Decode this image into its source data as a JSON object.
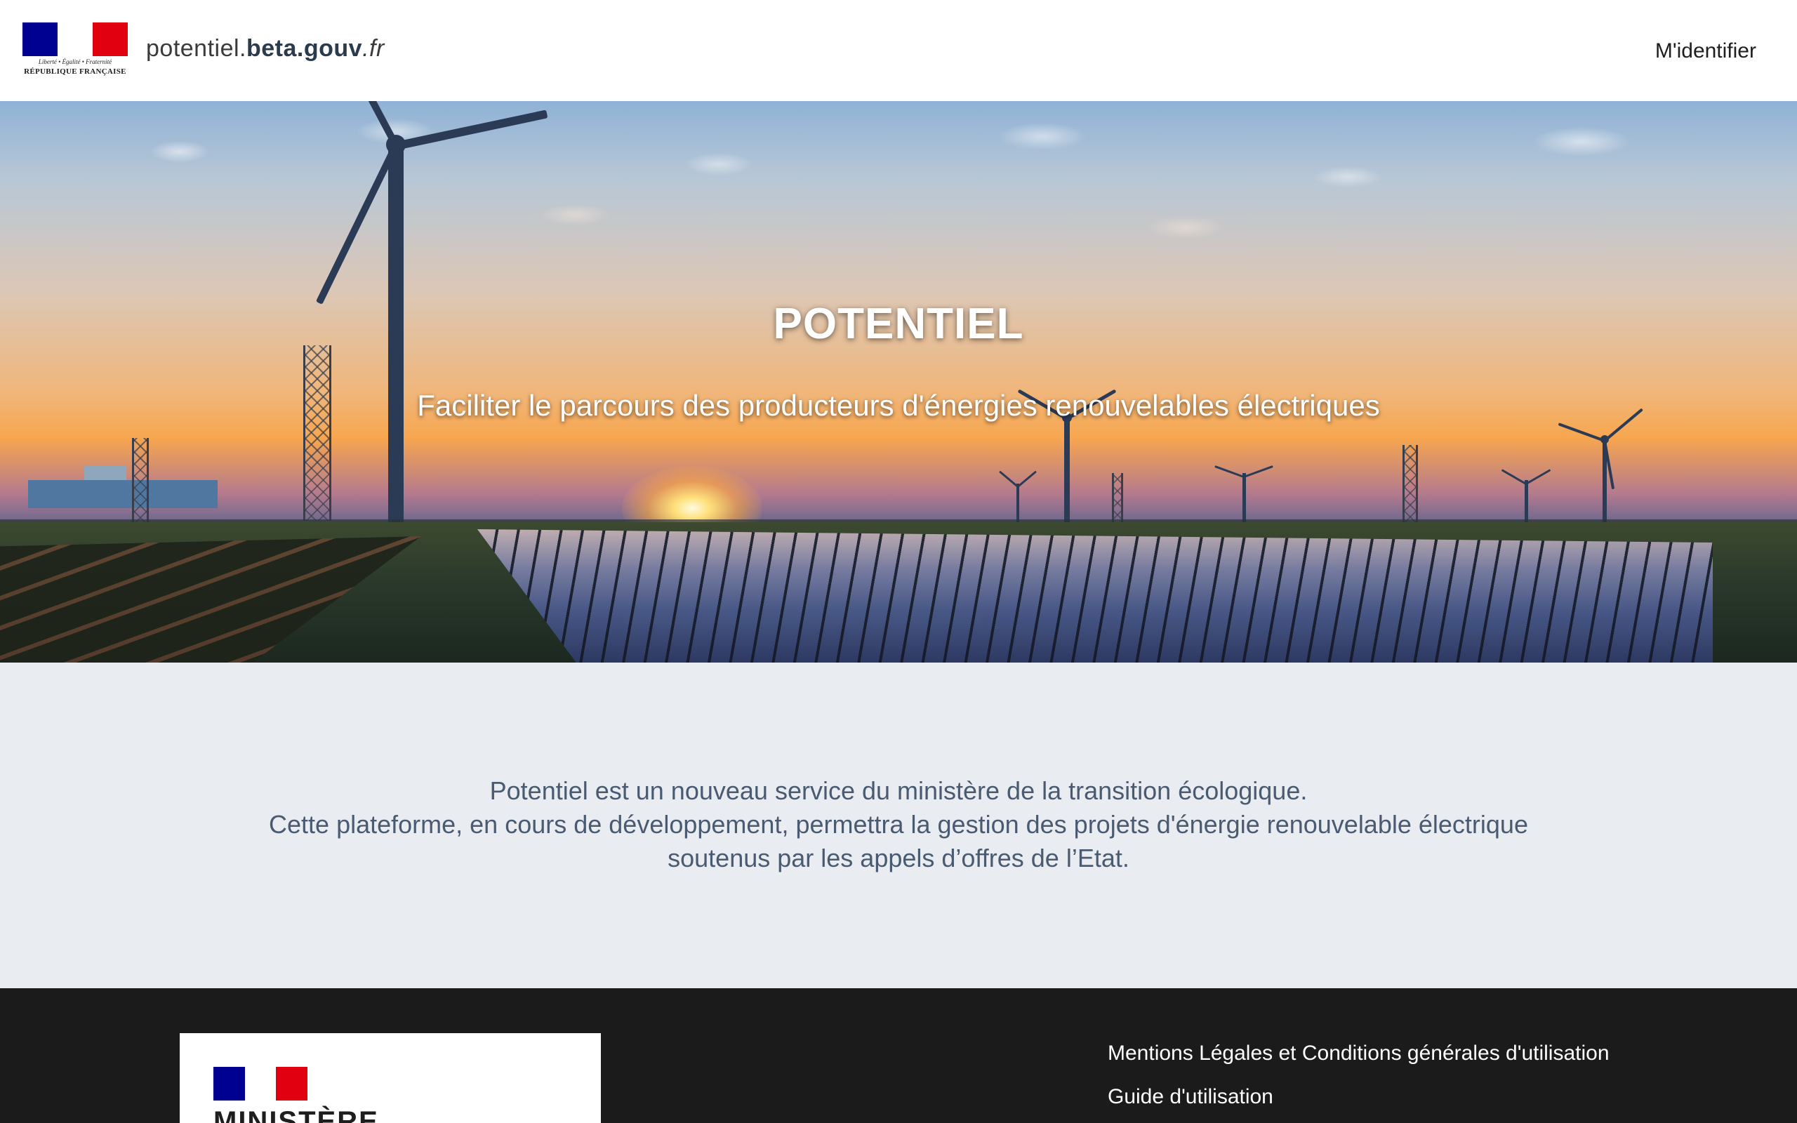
{
  "header": {
    "logo": {
      "motto": "Liberté • Égalité • Fraternité",
      "republic": "RÉPUBLIQUE FRANÇAISE",
      "icon": "marianne-logo"
    },
    "site_name": {
      "prefix": "potentiel.",
      "bold": "beta.gouv",
      "suffix": ".fr"
    },
    "login_label": "M'identifier"
  },
  "hero": {
    "title": "POTENTIEL",
    "subtitle": "Faciliter le parcours des producteurs d'énergies renouvelables électriques"
  },
  "intro": {
    "line1": "Potentiel est un nouveau service du ministère de la transition écologique.",
    "line2": "Cette plateforme, en cours de développement, permettra la gestion des projets d'énergie renouvelable électrique",
    "line3": "soutenus par les appels d’offres de l’Etat."
  },
  "footer": {
    "ministry_text": "MINISTÈRE",
    "links": [
      "Mentions Légales et Conditions générales d'utilisation",
      "Guide d'utilisation"
    ]
  },
  "colors": {
    "flag_blue": "#000091",
    "flag_red": "#e1000f",
    "intro_bg": "#e9edf2",
    "intro_text": "#4a5a70",
    "footer_bg": "#1b1b1b"
  }
}
